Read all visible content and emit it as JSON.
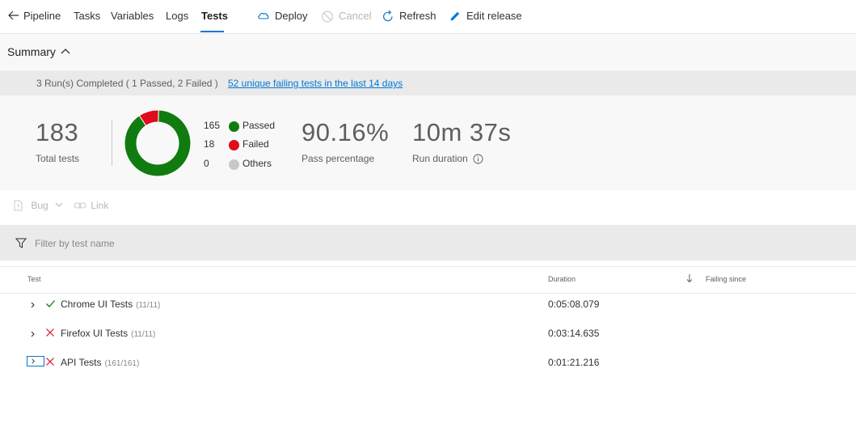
{
  "nav": {
    "back_label": "Pipeline",
    "tabs": [
      "Tasks",
      "Variables",
      "Logs",
      "Tests"
    ],
    "active_tab": "Tests"
  },
  "commands": {
    "deploy": "Deploy",
    "cancel": "Cancel",
    "refresh": "Refresh",
    "edit_release": "Edit release"
  },
  "summary": {
    "title": "Summary",
    "runs_text": "3 Run(s) Completed ( 1 Passed, 2 Failed )",
    "failing_link": "52 unique failing tests in the last 14 days",
    "total_tests": "183",
    "total_tests_label": "Total tests",
    "pass_percentage": "90.16%",
    "pass_percentage_label": "Pass percentage",
    "run_duration": "10m 37s",
    "run_duration_label": "Run duration",
    "legend": [
      {
        "count": "165",
        "label": "Passed",
        "color": "#107c10"
      },
      {
        "count": "18",
        "label": "Failed",
        "color": "#e00b1c"
      },
      {
        "count": "0",
        "label": "Others",
        "color": "#c8c8c8"
      }
    ],
    "donut_values": {
      "passed": 165,
      "failed": 18,
      "others": 0
    }
  },
  "actions": {
    "bug": "Bug",
    "link": "Link"
  },
  "filter": {
    "placeholder": "Filter by test name"
  },
  "table": {
    "headers": {
      "test": "Test",
      "duration": "Duration",
      "failing_since": "Failing since"
    },
    "rows": [
      {
        "name": "Chrome UI Tests",
        "count": "(11/11)",
        "duration": "0:05:08.079",
        "status": "passed"
      },
      {
        "name": "Firefox UI Tests",
        "count": "(11/11)",
        "duration": "0:03:14.635",
        "status": "failed"
      },
      {
        "name": "API Tests",
        "count": "(161/161)",
        "duration": "0:01:21.216",
        "status": "failed"
      }
    ]
  },
  "colors": {
    "accent": "#0078d4",
    "passed": "#107c10",
    "failed": "#e00b1c"
  }
}
